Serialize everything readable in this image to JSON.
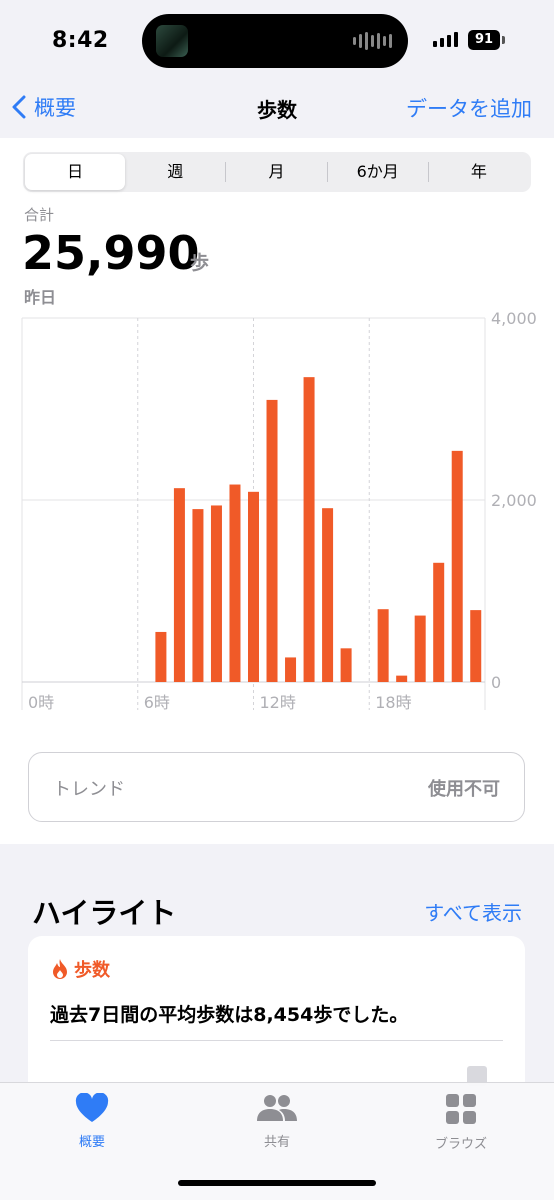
{
  "status_bar": {
    "time": "8:42",
    "battery": "91"
  },
  "nav": {
    "back_label": "概要",
    "title": "歩数",
    "add_label": "データを追加"
  },
  "segments": [
    "日",
    "週",
    "月",
    "6か月",
    "年"
  ],
  "active_segment": "日",
  "summary": {
    "label": "合計",
    "value": "25,990",
    "unit": "歩",
    "date": "昨日"
  },
  "chart_data": {
    "type": "bar",
    "x_ticks": [
      "0時",
      "6時",
      "12時",
      "18時"
    ],
    "y_ticks": [
      "4,000",
      "2,000",
      "0"
    ],
    "ylim": [
      0,
      4000
    ],
    "grid": true,
    "x": [
      0,
      1,
      2,
      3,
      4,
      5,
      6,
      7,
      8,
      9,
      10,
      11,
      12,
      13,
      14,
      15,
      16,
      17,
      18,
      19,
      20,
      21,
      22,
      23
    ],
    "values": [
      0,
      0,
      0,
      0,
      0,
      0,
      0,
      550,
      2130,
      1900,
      1940,
      2170,
      2090,
      3100,
      270,
      3350,
      1910,
      370,
      0,
      800,
      70,
      730,
      1310,
      2540,
      790
    ],
    "color": "#f05a28"
  },
  "trend": {
    "label": "トレンド",
    "status": "使用不可"
  },
  "highlights": {
    "title": "ハイライト",
    "show_all": "すべて表示",
    "category": "歩数",
    "text": "過去7日間の平均歩数は8,454歩でした。"
  },
  "tabs": [
    {
      "label": "概要",
      "icon": "heart-icon",
      "active": true
    },
    {
      "label": "共有",
      "icon": "people-icon",
      "active": false
    },
    {
      "label": "ブラウズ",
      "icon": "grid-icon",
      "active": false
    }
  ],
  "colors": {
    "accent": "#2f7cf6",
    "bar": "#f05a28",
    "secondary_text": "#8e8e93"
  }
}
